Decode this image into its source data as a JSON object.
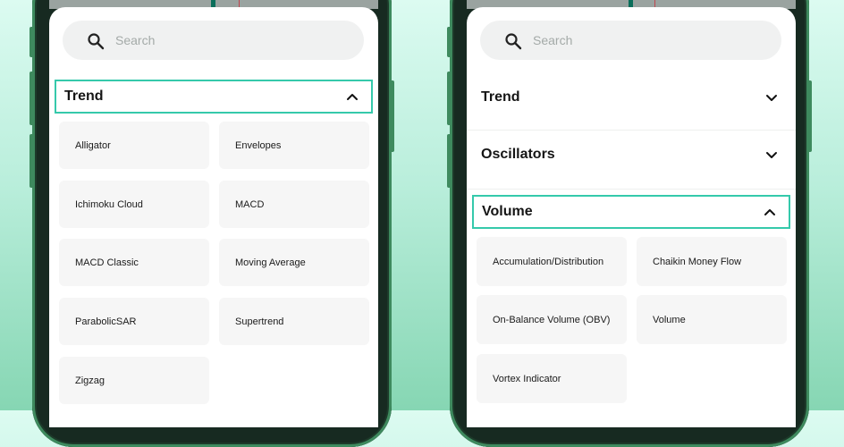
{
  "left_panel": {
    "search": {
      "placeholder": "Search"
    },
    "sections": [
      {
        "label": "Trend",
        "expanded": true,
        "items": [
          "Alligator",
          "Envelopes",
          "Ichimoku Cloud",
          "MACD",
          "MACD Classic",
          "Moving Average",
          "ParabolicSAR",
          "Supertrend",
          "Zigzag"
        ]
      }
    ]
  },
  "right_panel": {
    "search": {
      "placeholder": "Search"
    },
    "sections": [
      {
        "label": "Trend",
        "expanded": false
      },
      {
        "label": "Oscillators",
        "expanded": false
      },
      {
        "label": "Volume",
        "expanded": true,
        "items": [
          "Accumulation/Distribution",
          "Chaikin Money Flow",
          "On-Balance Volume (OBV)",
          "Volume",
          "Vortex Indicator"
        ]
      }
    ]
  },
  "icons": {
    "search": "search-icon",
    "expand": "chevron-down-icon",
    "collapse": "chevron-up-icon"
  },
  "colors": {
    "accent": "#35c9ab",
    "item_bg": "#f6f6f6",
    "search_bg": "#f0f1f1",
    "phone_frame": "#172a21"
  }
}
